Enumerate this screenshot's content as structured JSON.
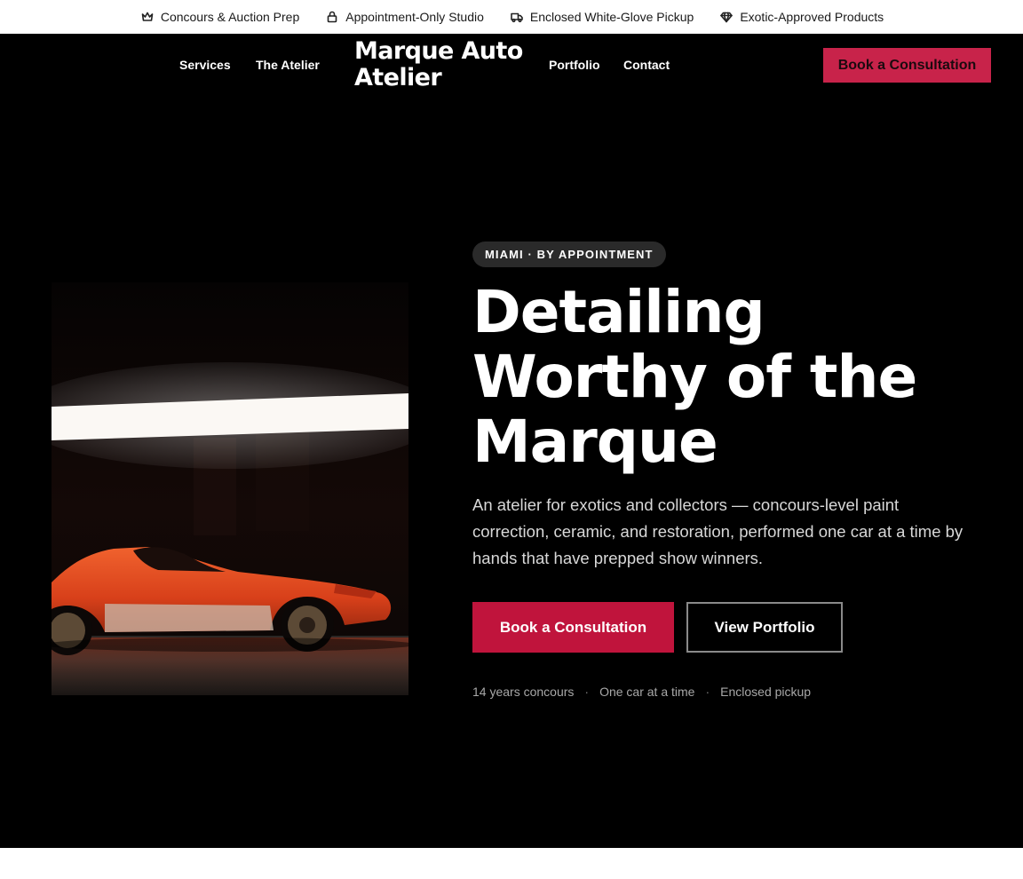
{
  "topbar": {
    "items": [
      {
        "icon": "crown-icon",
        "label": "Concours & Auction Prep"
      },
      {
        "icon": "lock-icon",
        "label": "Appointment-Only Studio"
      },
      {
        "icon": "truck-icon",
        "label": "Enclosed White-Glove Pickup"
      },
      {
        "icon": "diamond-icon",
        "label": "Exotic-Approved Products"
      }
    ]
  },
  "nav": {
    "links": [
      "Services",
      "The Atelier",
      "Portfolio",
      "Contact"
    ],
    "logo": "Marque Auto Atelier",
    "cta": "Book a Consultation"
  },
  "hero": {
    "eyebrow": "MIAMI · BY APPOINTMENT",
    "headline": "Detailing Worthy of the Marque",
    "lede": "An atelier for exotics and collectors — concours-level paint correction, ceramic, and restoration, performed one car at a time by hands that have prepped show winners.",
    "primary_cta": "Book a Consultation",
    "secondary_cta": "View Portfolio",
    "stats": [
      "14 years concours",
      "One car at a time",
      "Enclosed pickup"
    ],
    "stats_separator": "·"
  },
  "colors": {
    "accent": "#c0143c",
    "nav_cta": "#c8234a",
    "hero_bg": "#000000",
    "car_orange": "#e2461c"
  }
}
